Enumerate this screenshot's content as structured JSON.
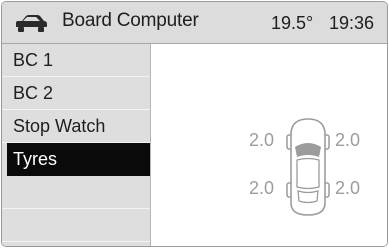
{
  "header": {
    "title": "Board Computer",
    "temperature": "19.5°",
    "time": "19:36"
  },
  "menu": {
    "items": [
      {
        "label": "BC 1"
      },
      {
        "label": "BC 2"
      },
      {
        "label": "Stop Watch"
      },
      {
        "label": "Tyres",
        "selected": true
      }
    ]
  },
  "tyres": {
    "front_left": "2.0",
    "front_right": "2.0",
    "rear_left": "2.0",
    "rear_right": "2.0"
  },
  "colors": {
    "header_bg": "#dcdcdc",
    "menu_bg": "#dedede",
    "selected_bg": "#0a0a0a",
    "tyre_text": "#9c9c9c"
  },
  "icons": {
    "header": "car-icon",
    "tyre_diagram": "car-top-view-icon"
  }
}
